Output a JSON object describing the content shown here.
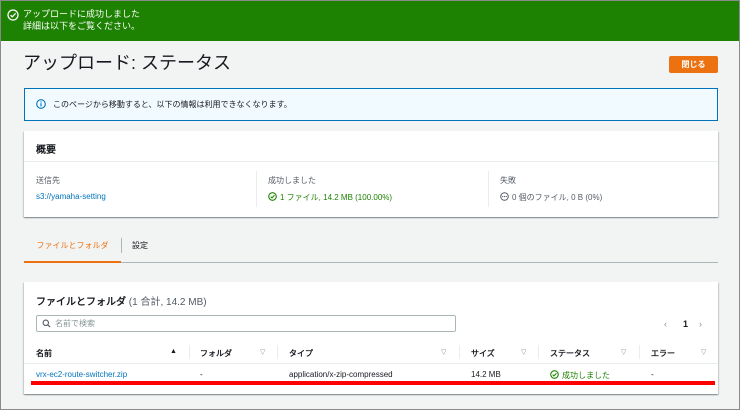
{
  "flash": {
    "title": "アップロードに成功しました",
    "detail": "詳細は以下をご覧ください。"
  },
  "header": {
    "title": "アップロード: ステータス",
    "close_label": "閉じる"
  },
  "info": {
    "text": "このページから移動すると、以下の情報は利用できなくなります。"
  },
  "summary": {
    "title": "概要",
    "destination_label": "送信先",
    "destination_value": "s3://yamaha-setting",
    "succeeded_label": "成功しました",
    "succeeded_value": "1 ファイル, 14.2 MB (100.00%)",
    "failed_label": "失敗",
    "failed_value": "0 個のファイル, 0 B (0%)"
  },
  "tabs": [
    {
      "label": "ファイルとフォルダ",
      "active": true
    },
    {
      "label": "設定",
      "active": false
    }
  ],
  "files": {
    "title": "ファイルとフォルダ",
    "count": "(1 合計, 14.2 MB)",
    "search_placeholder": "名前で検索",
    "page": "1",
    "columns": [
      "名前",
      "フォルダ",
      "タイプ",
      "サイズ",
      "ステータス",
      "エラー"
    ],
    "rows": [
      {
        "name": "vrx-ec2-route-switcher.zip",
        "folder": "-",
        "type": "application/x-zip-compressed",
        "size": "14.2 MB",
        "status": "成功しました",
        "error": "-"
      }
    ]
  },
  "colors": {
    "flash_bg": "#1d8102",
    "accent": "#ec7211",
    "link": "#0073bb",
    "success": "#1d8102",
    "highlight": "#ff0000"
  }
}
